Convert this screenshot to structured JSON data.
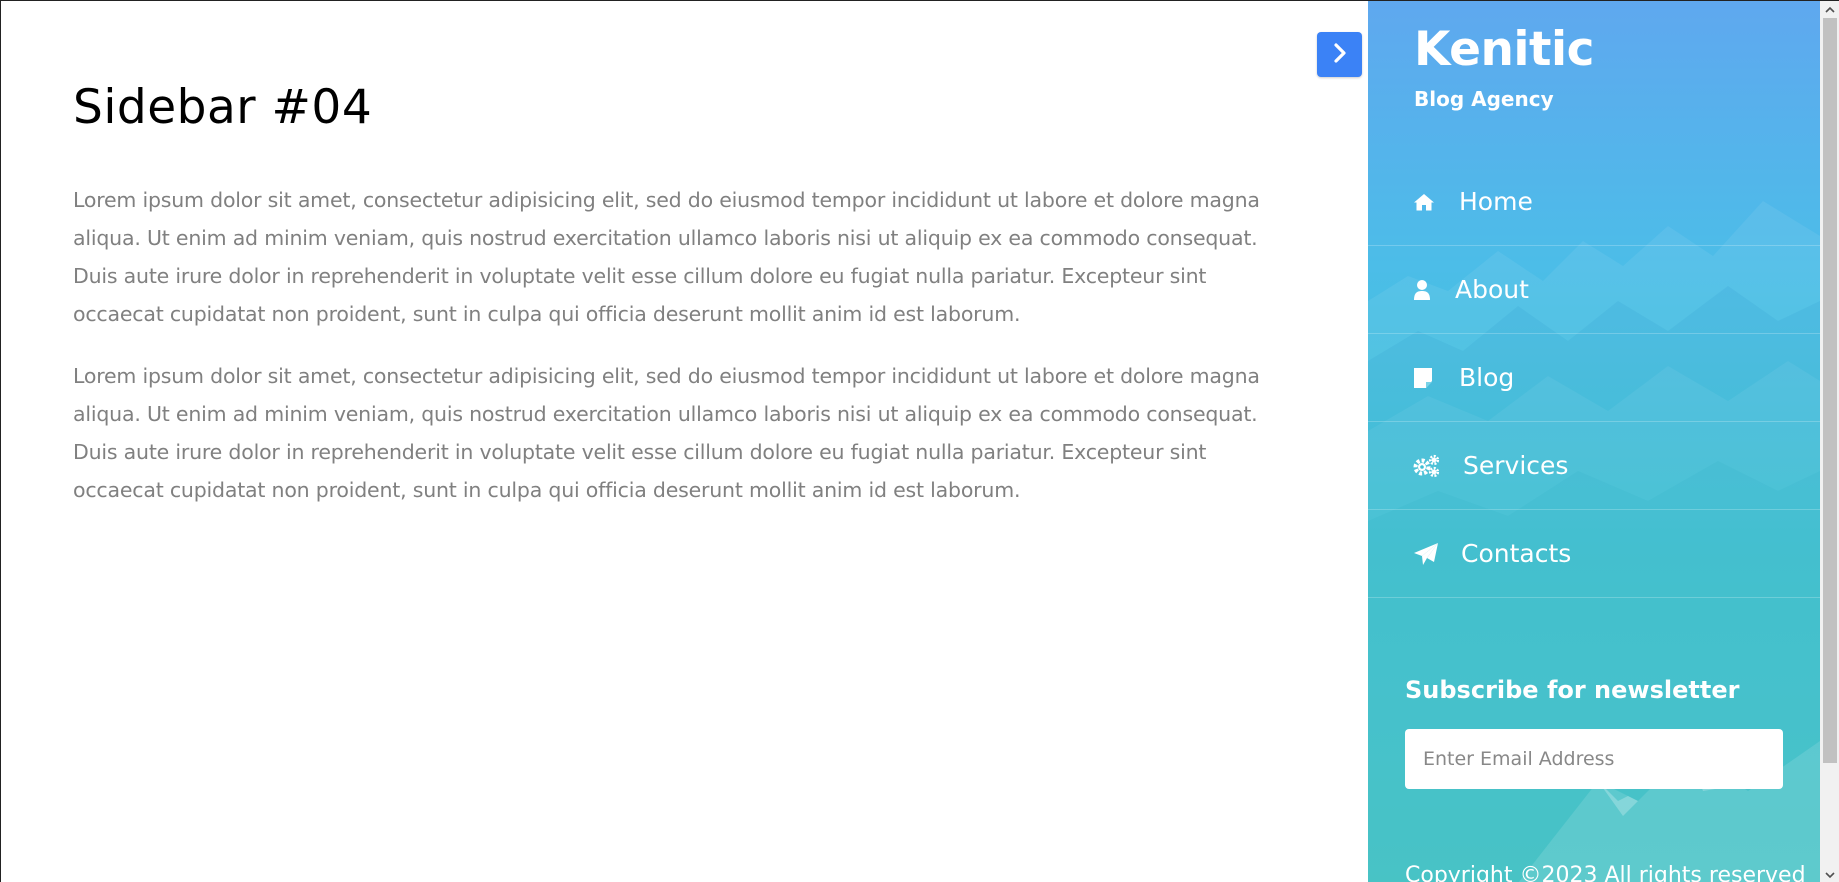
{
  "main": {
    "title": "Sidebar #04",
    "paragraphs": [
      "Lorem ipsum dolor sit amet, consectetur adipisicing elit, sed do eiusmod tempor incididunt ut labore et dolore magna aliqua. Ut enim ad minim veniam, quis nostrud exercitation ullamco laboris nisi ut aliquip ex ea commodo consequat. Duis aute irure dolor in reprehenderit in voluptate velit esse cillum dolore eu fugiat nulla pariatur. Excepteur sint occaecat cupidatat non proident, sunt in culpa qui officia deserunt mollit anim id est laborum.",
      "Lorem ipsum dolor sit amet, consectetur adipisicing elit, sed do eiusmod tempor incididunt ut labore et dolore magna aliqua. Ut enim ad minim veniam, quis nostrud exercitation ullamco laboris nisi ut aliquip ex ea commodo consequat. Duis aute irure dolor in reprehenderit in voluptate velit esse cillum dolore eu fugiat nulla pariatur. Excepteur sint occaecat cupidatat non proident, sunt in culpa qui officia deserunt mollit anim id est laborum."
    ]
  },
  "toggle": {
    "icon": "chevron-right-icon"
  },
  "sidebar": {
    "brand": "Kenitic",
    "tagline": "Blog Agency",
    "items": [
      {
        "label": "Home",
        "icon": "home-icon"
      },
      {
        "label": "About",
        "icon": "user-icon"
      },
      {
        "label": "Blog",
        "icon": "sticky-note-icon"
      },
      {
        "label": "Services",
        "icon": "gears-icon"
      },
      {
        "label": "Contacts",
        "icon": "paper-plane-icon"
      }
    ],
    "newsletter": {
      "title": "Subscribe for newsletter",
      "email_placeholder": "Enter Email Address",
      "email_value": ""
    },
    "copyright": "Copyright ©2023 All rights reserved"
  },
  "colors": {
    "accent": "#3b82f6",
    "sidebar_top": "#5fa8ef",
    "sidebar_bottom": "#3ac9c0",
    "body_text": "#808080"
  }
}
